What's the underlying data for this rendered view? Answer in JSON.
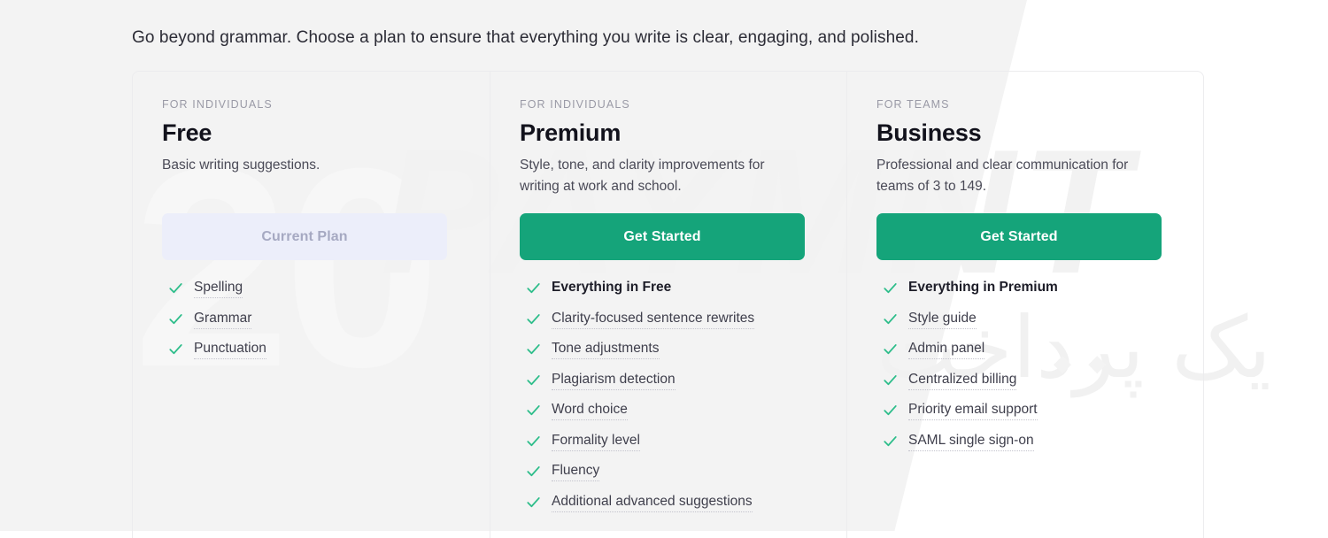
{
  "intro": {
    "text": "Go beyond grammar. Choose a plan to ensure that everything you write is clear, engaging, and polished."
  },
  "colors": {
    "primary_green": "#15a47a",
    "current_plan_bg": "#eceefa",
    "current_plan_text": "#a6a9c2",
    "heading_text": "#12121c",
    "body_text": "#4a4a57",
    "eyebrow_text": "#9a9aa6",
    "card_border": "#ececee",
    "check_green": "#2dbd8a"
  },
  "watermark": {
    "number": "20",
    "brand": "PAYMNT",
    "persian": "یک پرداخت",
    "diamonds": "◆ ◆"
  },
  "icons": {
    "check": "check-icon"
  },
  "plans": [
    {
      "eyebrow": "FOR INDIVIDUALS",
      "name": "Free",
      "description": "Basic writing suggestions.",
      "cta_label": "Current Plan",
      "cta_state": "current",
      "features": [
        {
          "label": "Spelling",
          "bold": false
        },
        {
          "label": "Grammar",
          "bold": false
        },
        {
          "label": "Punctuation",
          "bold": false
        }
      ]
    },
    {
      "eyebrow": "FOR INDIVIDUALS",
      "name": "Premium",
      "description": "Style, tone, and clarity improvements for writing at work and school.",
      "cta_label": "Get Started",
      "cta_state": "primary",
      "features": [
        {
          "label": "Everything in Free",
          "bold": true
        },
        {
          "label": "Clarity-focused sentence rewrites",
          "bold": false
        },
        {
          "label": "Tone adjustments",
          "bold": false
        },
        {
          "label": "Plagiarism detection",
          "bold": false
        },
        {
          "label": "Word choice",
          "bold": false
        },
        {
          "label": "Formality level",
          "bold": false
        },
        {
          "label": "Fluency",
          "bold": false
        },
        {
          "label": "Additional advanced suggestions",
          "bold": false
        }
      ]
    },
    {
      "eyebrow": "FOR TEAMS",
      "name": "Business",
      "description": "Professional and clear communication for teams of 3 to 149.",
      "cta_label": "Get Started",
      "cta_state": "primary",
      "features": [
        {
          "label": "Everything in Premium",
          "bold": true
        },
        {
          "label": "Style guide",
          "bold": false
        },
        {
          "label": "Admin panel",
          "bold": false
        },
        {
          "label": "Centralized billing",
          "bold": false
        },
        {
          "label": "Priority email support",
          "bold": false
        },
        {
          "label": "SAML single sign-on",
          "bold": false
        }
      ]
    }
  ]
}
